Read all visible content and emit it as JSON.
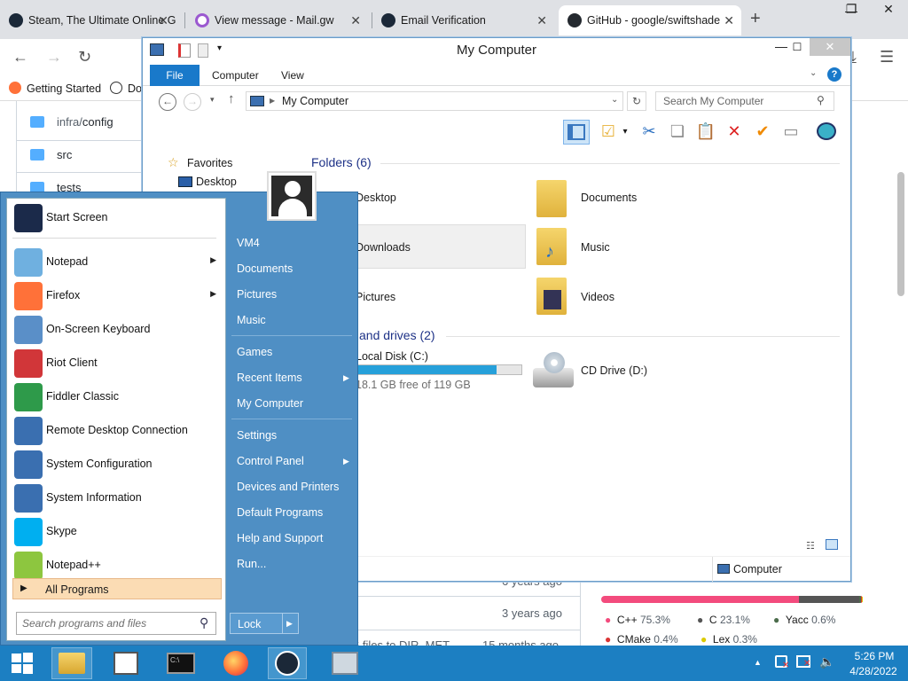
{
  "browser": {
    "tabs": [
      {
        "title": "Steam, The Ultimate Online G",
        "active": false
      },
      {
        "title": "View message - Mail.gw",
        "active": false
      },
      {
        "title": "Email Verification",
        "active": false
      },
      {
        "title": "GitHub - google/swiftshader",
        "active": true
      }
    ],
    "new_tab": "+",
    "bookmarks": [
      {
        "label": "Getting Started"
      },
      {
        "label": "Dov"
      }
    ]
  },
  "github": {
    "files": [
      {
        "name_dir": "infra/",
        "name_rest": "config"
      },
      {
        "name_dir": "",
        "name_rest": "src"
      },
      {
        "name_dir": "",
        "name_rest": "tests"
      }
    ],
    "commit_ages": [
      "6 years ago",
      "3 years ago",
      "15 months ago"
    ],
    "commit_msg_fragment": "6 files to DIR_MET",
    "languages": [
      {
        "name": "C++",
        "pct": "75.3%",
        "color": "#f34b7d",
        "share": 0.753
      },
      {
        "name": "C",
        "pct": "23.1%",
        "color": "#555555",
        "share": 0.231
      },
      {
        "name": "Yacc",
        "pct": "0.6%",
        "color": "#4b6c4b",
        "share": 0.006
      },
      {
        "name": "CMake",
        "pct": "0.4%",
        "color": "#da3434",
        "share": 0.004
      },
      {
        "name": "Lex",
        "pct": "0.3%",
        "color": "#dbca00",
        "share": 0.003
      }
    ]
  },
  "explorer": {
    "title": "My Computer",
    "ribbon_tabs": [
      "File",
      "Computer",
      "View"
    ],
    "address": "My Computer",
    "search_placeholder": "Search My Computer",
    "nav": {
      "favorites": "Favorites",
      "desktop": "Desktop"
    },
    "folders_header": "Folders (6)",
    "folders": [
      "Desktop",
      "Documents",
      "Downloads",
      "Music",
      "Pictures",
      "Videos"
    ],
    "drives_header_visible": "and drives (2)",
    "drives": [
      {
        "name": "Local Disk (C:)",
        "free": "18.1 GB free of 119 GB",
        "used_fraction": 0.85
      },
      {
        "name": "CD Drive (D:)"
      }
    ],
    "status_location": "Computer"
  },
  "start_menu": {
    "programs": [
      {
        "label": "Start Screen",
        "submenu": false,
        "icon": "start-screen-icon",
        "color": "#1b2a4a"
      },
      {
        "label": "Notepad",
        "submenu": true,
        "icon": "notepad-icon",
        "color": "#6fb0e0"
      },
      {
        "label": "Firefox",
        "submenu": true,
        "icon": "firefox-icon",
        "color": "#ff7139"
      },
      {
        "label": "On-Screen Keyboard",
        "submenu": false,
        "icon": "keyboard-icon",
        "color": "#5a8fc8"
      },
      {
        "label": "Riot Client",
        "submenu": false,
        "icon": "riot-icon",
        "color": "#d13639"
      },
      {
        "label": "Fiddler Classic",
        "submenu": false,
        "icon": "fiddler-icon",
        "color": "#2e9a4a"
      },
      {
        "label": "Remote Desktop Connection",
        "submenu": false,
        "icon": "remote-desktop-icon",
        "color": "#3a6fb0"
      },
      {
        "label": "System Configuration",
        "submenu": false,
        "icon": "system-config-icon",
        "color": "#3a6fb0"
      },
      {
        "label": "System Information",
        "submenu": false,
        "icon": "system-info-icon",
        "color": "#3a6fb0"
      },
      {
        "label": "Skype",
        "submenu": false,
        "icon": "skype-icon",
        "color": "#00aff0"
      },
      {
        "label": "Notepad++",
        "submenu": false,
        "icon": "notepadpp-icon",
        "color": "#8dc63f"
      }
    ],
    "all_programs": "All Programs",
    "search_placeholder": "Search programs and files",
    "right": {
      "user": "VM4",
      "group1": [
        "Documents",
        "Pictures",
        "Music"
      ],
      "group2": [
        {
          "label": "Games",
          "submenu": false
        },
        {
          "label": "Recent Items",
          "submenu": true
        },
        {
          "label": "My Computer",
          "submenu": false
        }
      ],
      "group3": [
        {
          "label": "Settings",
          "submenu": false
        },
        {
          "label": "Control Panel",
          "submenu": true
        },
        {
          "label": "Devices and Printers",
          "submenu": false
        },
        {
          "label": "Default Programs",
          "submenu": false
        },
        {
          "label": "Help and Support",
          "submenu": false
        },
        {
          "label": "Run...",
          "submenu": false
        }
      ]
    },
    "lock": "Lock"
  },
  "taskbar": {
    "time": "5:26 PM",
    "date": "4/28/2022"
  },
  "colors": {
    "taskbar": "#1c7fc2",
    "start_menu": "#4f8fc4",
    "ribbon_file": "#1979ca",
    "drive_bar": "#26a0da"
  }
}
